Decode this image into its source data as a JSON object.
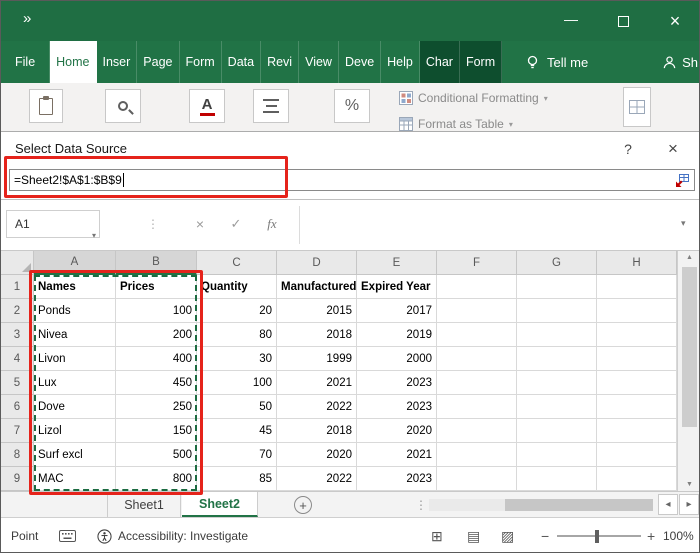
{
  "window": {
    "overflow_chevron": "»"
  },
  "icons": {
    "minimize": "—",
    "close": "×",
    "dialog_help": "?",
    "dialog_close": "×",
    "dropdown": "▾",
    "dots": "⋮",
    "formula_cancel": "×",
    "formula_enter": "✓",
    "fx": "fx",
    "add_sheet": "+",
    "scroll_left": "◂",
    "scroll_right": "▸",
    "scroll_up": "▲",
    "scroll_down": "▼",
    "view_normal": "⊞",
    "view_page_layout": "▤",
    "view_page_break": "▨",
    "zoom_out": "−",
    "zoom_in": "+"
  },
  "ribbon": {
    "tabs": [
      {
        "label": "File",
        "style": "file"
      },
      {
        "label": "Home",
        "style": "selected"
      },
      {
        "label": "Inser",
        "style": "normal"
      },
      {
        "label": "Page",
        "style": "normal"
      },
      {
        "label": "Form",
        "style": "normal"
      },
      {
        "label": "Data",
        "style": "normal"
      },
      {
        "label": "Revi",
        "style": "normal"
      },
      {
        "label": "View",
        "style": "normal"
      },
      {
        "label": "Deve",
        "style": "normal"
      },
      {
        "label": "Help",
        "style": "normal"
      },
      {
        "label": "Char",
        "style": "contextual"
      },
      {
        "label": "Form",
        "style": "contextual"
      }
    ],
    "tell_me": "Tell me",
    "share": "Sh",
    "conditional_formatting": "Conditional Formatting",
    "format_as_table": "Format as Table"
  },
  "dialog": {
    "title": "Select Data Source",
    "range_input": "=Sheet2!$A$1:$B$9"
  },
  "formula_bar": {
    "name_box": "A1"
  },
  "sheet": {
    "columns": [
      "A",
      "B",
      "C",
      "D",
      "E",
      "F",
      "G",
      "H"
    ],
    "selected_columns": [
      "A",
      "B"
    ],
    "selected_range": "A1:B9",
    "rows": [
      {
        "n": "1",
        "cells": [
          "Names",
          "Prices",
          "Quantity",
          "Manufactured Year",
          "Expired Year",
          "",
          "",
          ""
        ]
      },
      {
        "n": "2",
        "cells": [
          "Ponds",
          "100",
          "20",
          "2015",
          "2017",
          "",
          "",
          ""
        ]
      },
      {
        "n": "3",
        "cells": [
          "Nivea",
          "200",
          "80",
          "2018",
          "2019",
          "",
          "",
          ""
        ]
      },
      {
        "n": "4",
        "cells": [
          "Livon",
          "400",
          "30",
          "1999",
          "2000",
          "",
          "",
          ""
        ]
      },
      {
        "n": "5",
        "cells": [
          "Lux",
          "450",
          "100",
          "2021",
          "2023",
          "",
          "",
          ""
        ]
      },
      {
        "n": "6",
        "cells": [
          "Dove",
          "250",
          "50",
          "2022",
          "2023",
          "",
          "",
          ""
        ]
      },
      {
        "n": "7",
        "cells": [
          "Lizol",
          "150",
          "45",
          "2018",
          "2020",
          "",
          "",
          ""
        ]
      },
      {
        "n": "8",
        "cells": [
          "Surf excl",
          "500",
          "70",
          "2020",
          "2021",
          "",
          "",
          ""
        ]
      },
      {
        "n": "9",
        "cells": [
          "MAC",
          "800",
          "85",
          "2022",
          "2023",
          "",
          "",
          ""
        ]
      }
    ]
  },
  "sheet_tabs": [
    {
      "label": "Sheet1",
      "selected": false
    },
    {
      "label": "Sheet2",
      "selected": true
    }
  ],
  "status_bar": {
    "mode": "Point",
    "accessibility": "Accessibility: Investigate",
    "zoom_level": "100%"
  },
  "colors": {
    "excel_green": "#217346",
    "contextual_tab_green": "#0e4e2e",
    "annotation_red": "#e5231b",
    "selection_dash_green": "#1c6b41"
  }
}
